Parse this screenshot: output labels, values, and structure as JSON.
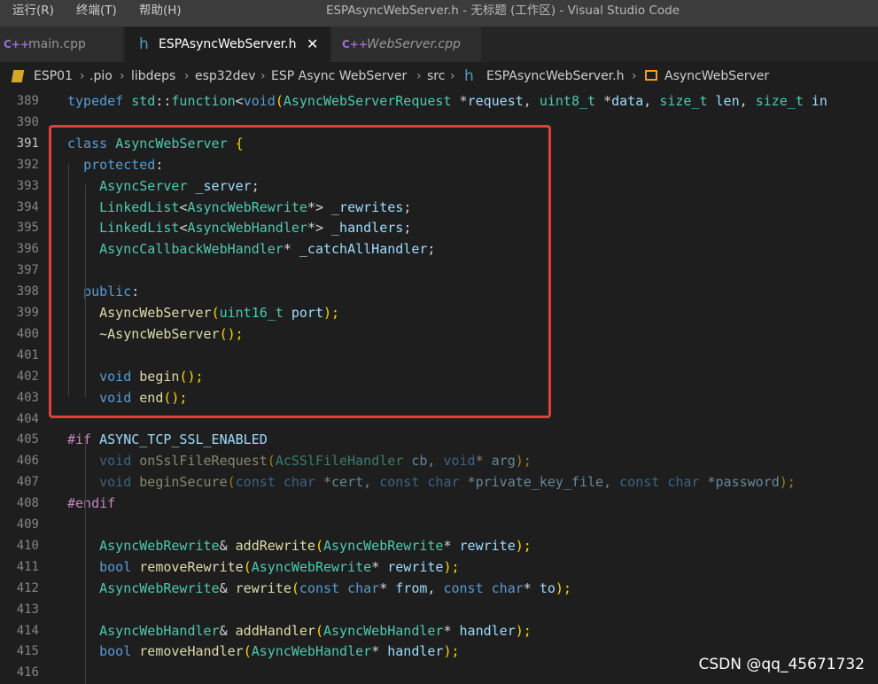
{
  "menubar": {
    "items": [
      "运行(R)",
      "终端(T)",
      "帮助(H)"
    ]
  },
  "window_title": "ESPAsyncWebServer.h - 无标题 (工作区) - Visual Studio Code",
  "tabs": [
    {
      "icon_glyph": "C++",
      "label": "main.cpp"
    },
    {
      "icon_glyph": "h",
      "label": "ESPAsyncWebServer.h",
      "close": "✕"
    },
    {
      "icon_glyph": "C++",
      "label": "WebServer.cpp"
    }
  ],
  "breadcrumb": [
    "ESP01",
    ".pio",
    "libdeps",
    "esp32dev",
    "ESP Async WebServer",
    "src",
    "ESPAsyncWebServer.h",
    "AsyncWebServer"
  ],
  "breadcrumb_glyphs": {
    "file_h": "h",
    "sep": "›"
  },
  "colors": {
    "keyword": "#569cd6",
    "type": "#4ec9b0",
    "function": "#dcdcaa",
    "variable": "#9cdcfe",
    "highlight_box": "#e0403a",
    "background": "#1e1e1e"
  },
  "code_lines": [
    {
      "n": "389",
      "t": "typedef std::function<void(AsyncWebServerRequest *request, uint8_t *data, size_t len, size_t in"
    },
    {
      "n": "390",
      "t": ""
    },
    {
      "n": "391",
      "t": "class AsyncWebServer {"
    },
    {
      "n": "392",
      "t": "  protected:"
    },
    {
      "n": "393",
      "t": "    AsyncServer _server;"
    },
    {
      "n": "394",
      "t": "    LinkedList<AsyncWebRewrite*> _rewrites;"
    },
    {
      "n": "395",
      "t": "    LinkedList<AsyncWebHandler*> _handlers;"
    },
    {
      "n": "396",
      "t": "    AsyncCallbackWebHandler* _catchAllHandler;"
    },
    {
      "n": "397",
      "t": ""
    },
    {
      "n": "398",
      "t": "  public:"
    },
    {
      "n": "399",
      "t": "    AsyncWebServer(uint16_t port);"
    },
    {
      "n": "400",
      "t": "    ~AsyncWebServer();"
    },
    {
      "n": "401",
      "t": ""
    },
    {
      "n": "402",
      "t": "    void begin();"
    },
    {
      "n": "403",
      "t": "    void end();"
    },
    {
      "n": "404",
      "t": ""
    },
    {
      "n": "405",
      "t": "#if ASYNC_TCP_SSL_ENABLED"
    },
    {
      "n": "406",
      "t": "    void onSslFileRequest(AcSSlFileHandler cb, void* arg);"
    },
    {
      "n": "407",
      "t": "    void beginSecure(const char *cert, const char *private_key_file, const char *password);"
    },
    {
      "n": "408",
      "t": "#endif"
    },
    {
      "n": "409",
      "t": ""
    },
    {
      "n": "410",
      "t": "    AsyncWebRewrite& addRewrite(AsyncWebRewrite* rewrite);"
    },
    {
      "n": "411",
      "t": "    bool removeRewrite(AsyncWebRewrite* rewrite);"
    },
    {
      "n": "412",
      "t": "    AsyncWebRewrite& rewrite(const char* from, const char* to);"
    },
    {
      "n": "413",
      "t": ""
    },
    {
      "n": "414",
      "t": "    AsyncWebHandler& addHandler(AsyncWebHandler* handler);"
    },
    {
      "n": "415",
      "t": "    bool removeHandler(AsyncWebHandler* handler);"
    },
    {
      "n": "416",
      "t": ""
    }
  ],
  "watermark": "CSDN @qq_45671732"
}
